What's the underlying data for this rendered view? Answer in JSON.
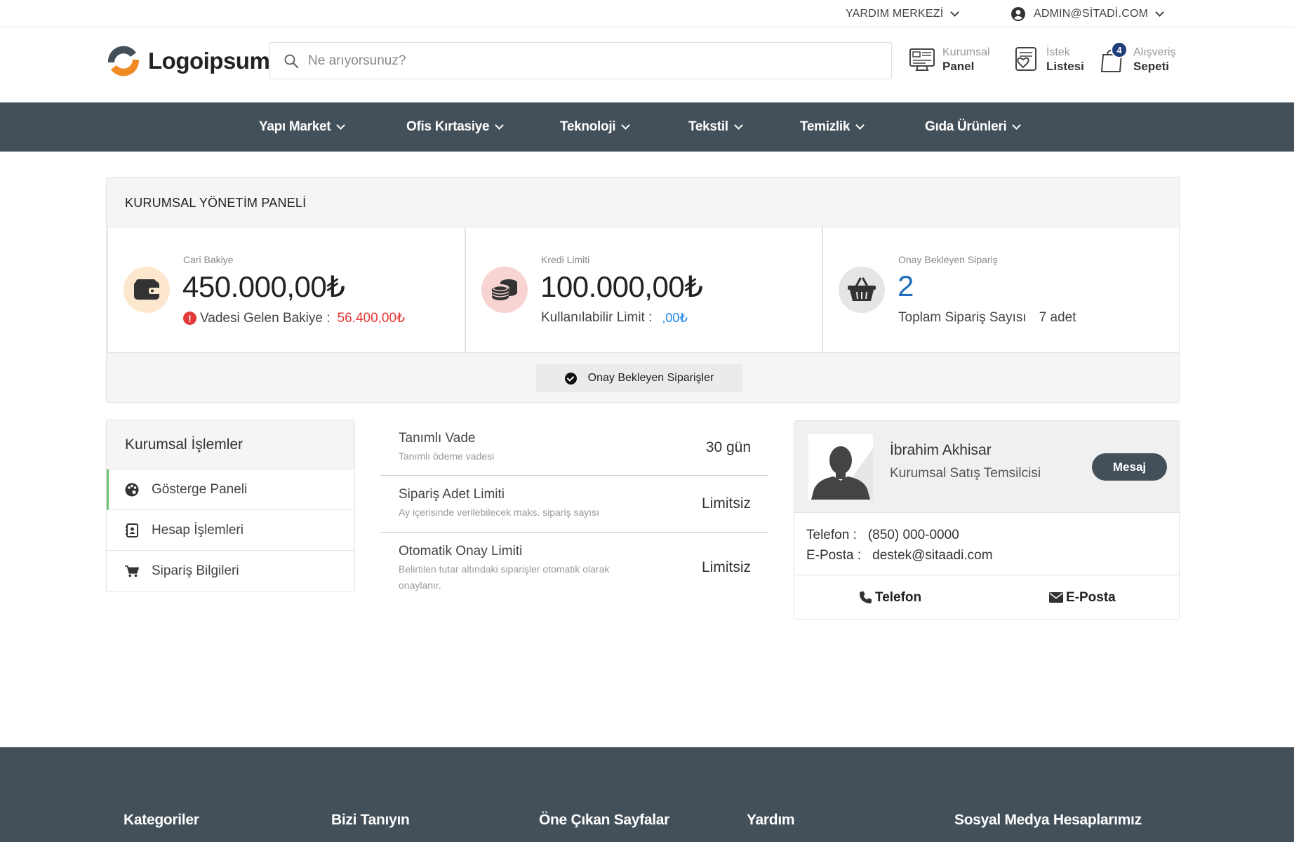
{
  "topbar": {
    "help": "YARDIM MERKEZİ",
    "account": "ADMIN@SİTADİ.COM"
  },
  "header": {
    "logo_text": "Logoipsum",
    "search_placeholder": "Ne arıyorsunuz?",
    "links": {
      "panel_top": "Kurumsal",
      "panel_bottom": "Panel",
      "wish_top": "İstek",
      "wish_bottom": "Listesi",
      "cart_top": "Alışveriş",
      "cart_bottom": "Sepeti",
      "cart_count": "4"
    }
  },
  "nav": {
    "items": [
      {
        "label": "Yapı Market"
      },
      {
        "label": "Ofis Kırtasiye"
      },
      {
        "label": "Teknoloji"
      },
      {
        "label": "Tekstil"
      },
      {
        "label": "Temizlik"
      },
      {
        "label": "Gıda Ürünleri"
      }
    ]
  },
  "panel": {
    "title": "KURUMSAL YÖNETİM PANELİ",
    "stats": [
      {
        "label": "Cari Bakiye",
        "value": "450.000,00₺",
        "sub_label": "Vadesi Gelen Bakiye :",
        "sub_value": "56.400,00₺"
      },
      {
        "label": "Kredi Limiti",
        "value": "100.000,00₺",
        "sub_label": "Kullanılabilir Limit :",
        "sub_value": ",00₺"
      },
      {
        "label": "Onay Bekleyen Sipariş",
        "value": "2",
        "sub_label": "Toplam Sipariş Sayısı",
        "sub_value": "7 adet"
      }
    ],
    "pending_button": "Onay Bekleyen Siparişler"
  },
  "side": {
    "title": "Kurumsal İşlemler",
    "items": [
      {
        "label": "Gösterge Paneli"
      },
      {
        "label": "Hesap İşlemleri"
      },
      {
        "label": "Sipariş Bilgileri"
      }
    ]
  },
  "info": {
    "rows": [
      {
        "title": "Tanımlı Vade",
        "desc": "Tanımlı ödeme vadesi",
        "value": "30 gün"
      },
      {
        "title": "Sipariş Adet Limiti",
        "desc": "Ay içerisinde verilebilecek maks. sipariş sayısı",
        "value": "Limitsiz"
      },
      {
        "title": "Otomatik Onay Limiti",
        "desc": "Belirtilen tutar altındaki siparişler otomatik olarak onaylanır.",
        "value": "Limitsiz"
      }
    ]
  },
  "rep": {
    "name": "İbrahim Akhisar",
    "role": "Kurumsal Satış Temsilcisi",
    "message_button": "Mesaj",
    "phone_label": "Telefon :",
    "phone_value": "(850) 000-0000",
    "email_label": "E-Posta :",
    "email_value": "destek@sitaadi.com",
    "action_phone": "Telefon",
    "action_email": "E-Posta"
  },
  "footer": {
    "headings": [
      "Kategoriler",
      "Bizi Tanıyın",
      "Öne Çıkan Sayfalar",
      "Yardım",
      "Sosyal Medya Hesaplarımız"
    ]
  },
  "colors": {
    "nav_bg": "#435059",
    "accent_green": "#6dc46f",
    "warning_red": "#e53935",
    "link_blue": "#1e88e5",
    "stat_blue": "#1f6fc0"
  }
}
